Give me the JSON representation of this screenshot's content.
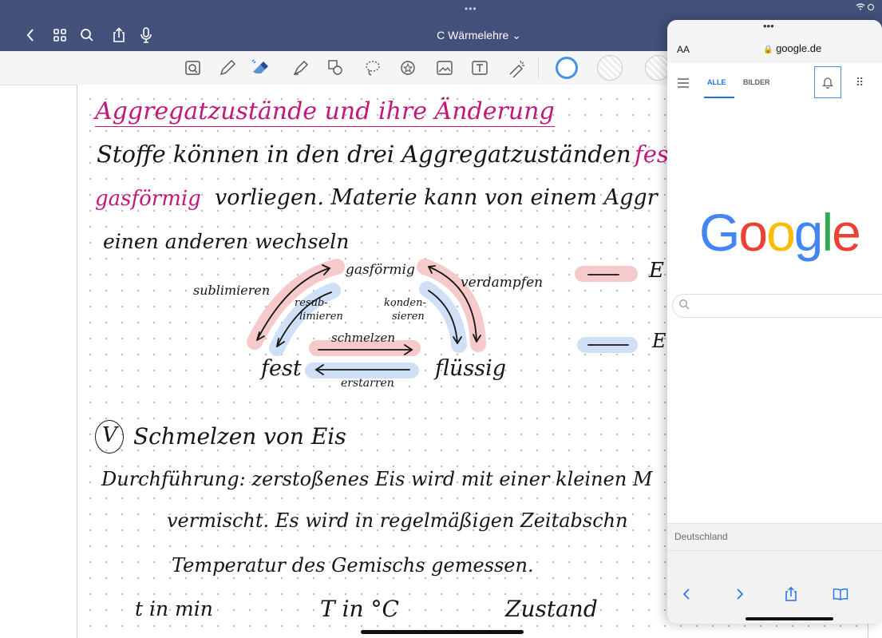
{
  "app": {
    "title": "C Wärmelehre ⌄",
    "top_dots": "•••"
  },
  "icons": {
    "back": "chevron-left-icon",
    "grid": "grid-icon",
    "search": "search-icon",
    "share": "share-icon",
    "mic": "microphone-icon"
  },
  "toolbar": {
    "tools": [
      "zoom-box",
      "pen",
      "eraser",
      "highlighter",
      "shapes",
      "lasso",
      "sticker",
      "image",
      "text-box",
      "laser-pointer"
    ],
    "selected_color": "#4a90e2"
  },
  "note": {
    "heading": "Aggregatzustände und ihre Änderung",
    "line1": "Stoffe können in den drei Aggregatzuständen",
    "line1_pink": "fest",
    "line2_pink": "gasförmig",
    "line2": "vorliegen. Materie kann von einem Aggr",
    "line3": "einen anderen wechseln",
    "diagram": {
      "gas": "gasförmig",
      "solid": "fest",
      "liquid": "flüssig",
      "sublimieren": "sublimieren",
      "resublimieren_1": "resub-",
      "resublimieren_2": "limieren",
      "kondensieren_1": "konden-",
      "kondensieren_2": "sieren",
      "verdampfen": "verdampfen",
      "schmelzen": "schmelzen",
      "erstarren": "erstarren",
      "legend_1": "E",
      "legend_2": "E"
    },
    "experiment_marker": "V",
    "experiment_title": "Schmelzen von Eis",
    "procedure_1": "Durchführung: zerstoßenes Eis wird mit einer kleinen M",
    "procedure_2": "vermischt. Es wird in regelmäßigen Zeitabschn",
    "procedure_3": "Temperatur des Gemischs gemessen.",
    "col_t": "t in min",
    "col_T": "T in °C",
    "col_state": "Zustand"
  },
  "safari": {
    "dots": "•••",
    "aa": "AA",
    "url": "google.de",
    "tab_all": "ALLE",
    "tab_images": "BILDER",
    "apps_glyph": "⠿",
    "logo_letters": [
      "G",
      "o",
      "o",
      "g",
      "l",
      "e"
    ],
    "logo_colors": [
      "#4285F4",
      "#EA4335",
      "#FBBC05",
      "#4285F4",
      "#34A853",
      "#EA4335"
    ],
    "footer_country": "Deutschland",
    "accent": "#1a73e8"
  }
}
